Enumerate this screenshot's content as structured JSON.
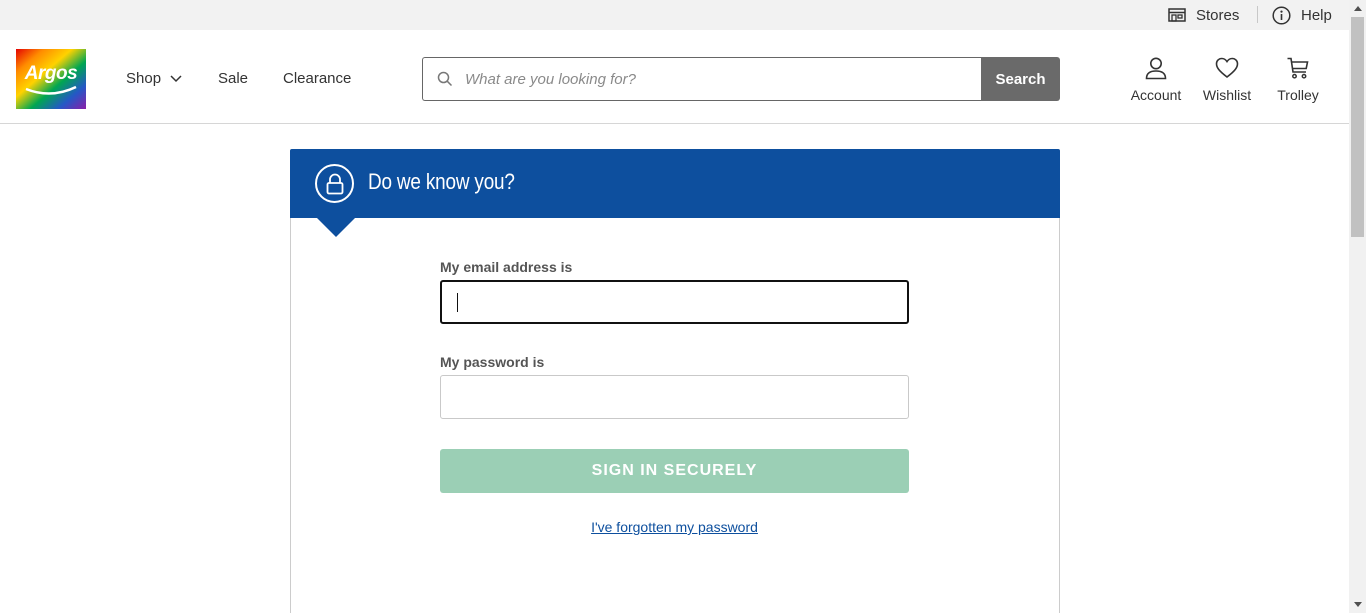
{
  "utility": {
    "stores_label": "Stores",
    "help_label": "Help"
  },
  "header": {
    "logo_text": "Argos",
    "nav": {
      "shop": "Shop",
      "sale": "Sale",
      "clearance": "Clearance"
    },
    "search": {
      "placeholder": "What are you looking for?",
      "value": "",
      "button_label": "Search"
    },
    "account_label": "Account",
    "wishlist_label": "Wishlist",
    "trolley_label": "Trolley"
  },
  "signin": {
    "title": "Do we know you?",
    "email_label": "My email address is",
    "email_value": "",
    "password_label": "My password is",
    "password_value": "",
    "submit_label": "SIGN IN SECURELY",
    "forgot_label": "I've forgotten my password"
  },
  "colors": {
    "brand_blue": "#0d4f9e",
    "signin_button_disabled": "#9bcfb5",
    "search_button": "#6a6a6a"
  },
  "icons": [
    "store-icon",
    "info-icon",
    "search-icon",
    "chevron-down-icon",
    "user-icon",
    "heart-icon",
    "trolley-icon",
    "lock-icon"
  ]
}
